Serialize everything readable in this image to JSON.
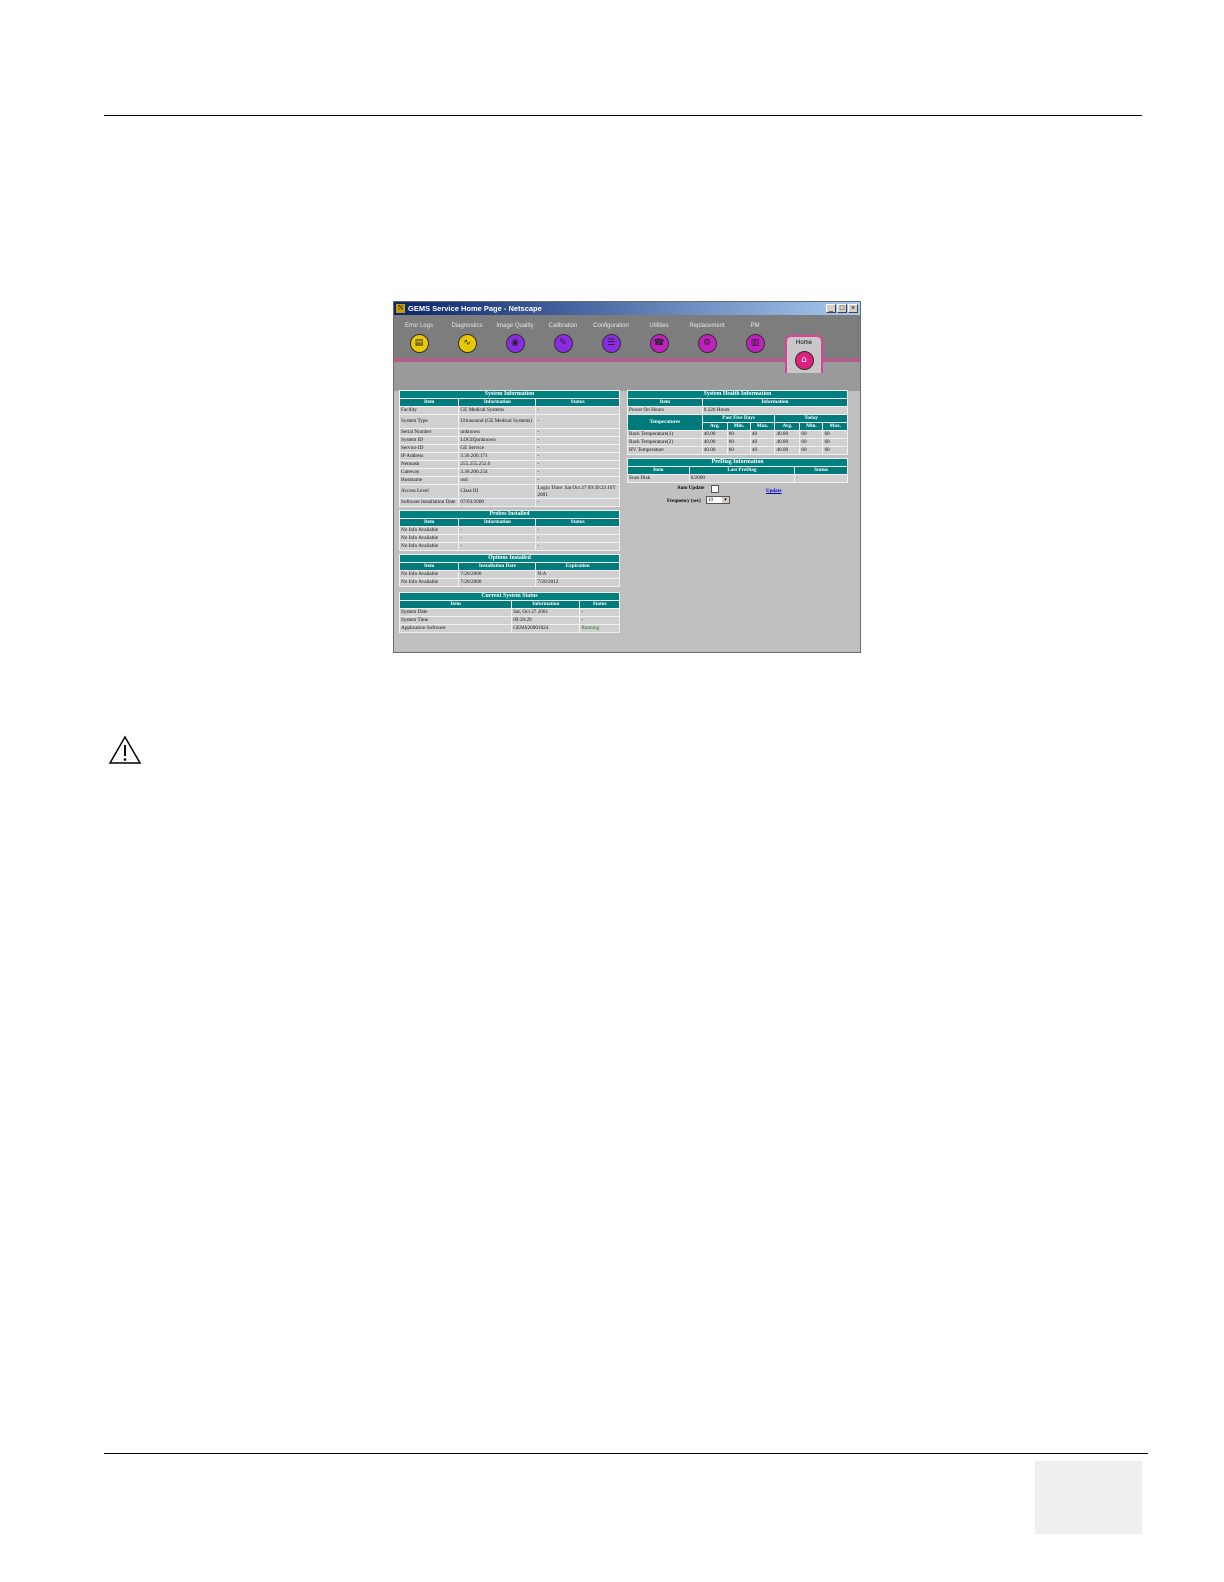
{
  "window": {
    "title": "GEMS Service Home Page - Netscape",
    "icon": "netscape-icon",
    "controls": [
      "_",
      "□",
      "×"
    ]
  },
  "nav": {
    "items": [
      {
        "label": "Error Logs",
        "icon": "log-icon",
        "color": "#e8c800"
      },
      {
        "label": "Diagnostics",
        "icon": "stethoscope-icon",
        "color": "#e8c800"
      },
      {
        "label": "Image Quality",
        "icon": "image-quality-icon",
        "color": "#8a2be2"
      },
      {
        "label": "Calibration",
        "icon": "calibration-icon",
        "color": "#8a2be2"
      },
      {
        "label": "Configuration",
        "icon": "configuration-icon",
        "color": "#8a2be2"
      },
      {
        "label": "Utilities",
        "icon": "utilities-icon",
        "color": "#c020c0"
      },
      {
        "label": "Replacement",
        "icon": "replacement-icon",
        "color": "#c020c0"
      },
      {
        "label": "PM",
        "icon": "pm-icon",
        "color": "#c020c0"
      }
    ],
    "home": {
      "label": "Home",
      "icon": "home-icon",
      "color": "#e02080"
    }
  },
  "system_info": {
    "caption": "System Information",
    "headers": [
      "Item",
      "Information",
      "Status"
    ],
    "rows": [
      [
        "Facility",
        "GE Medical Systems",
        "-"
      ],
      [
        "System Type",
        "Ultrasound (GE Medical Systems)",
        "-"
      ],
      [
        "Serial Number",
        "unknown",
        "-"
      ],
      [
        "System ID",
        "LOGIQunknown",
        "-"
      ],
      [
        "Service ID",
        "GE Service",
        "-"
      ],
      [
        "IP Address",
        "3.36.200.171",
        "-"
      ],
      [
        "Netmask",
        "255.255.252.0",
        "-"
      ],
      [
        "Gateway",
        "3.36.200.254",
        "-"
      ],
      [
        "Hostname",
        "usd",
        "-"
      ],
      [
        "Access Level",
        "Class III",
        "Login Time: Sat Oct 27 09:39:23 JST 2001"
      ],
      [
        "Software Installation Date",
        "07/03/2000",
        "-"
      ]
    ]
  },
  "probes": {
    "caption": "Probes Installed",
    "headers": [
      "Item",
      "Information",
      "Status"
    ],
    "rows": [
      [
        "No Info Available",
        "-",
        "-"
      ],
      [
        "No Info Available",
        "-",
        "-"
      ],
      [
        "No Info Available",
        "-",
        "-"
      ]
    ]
  },
  "options": {
    "caption": "Options Installed",
    "headers": [
      "Item",
      "Installation Date",
      "Expiration"
    ],
    "rows": [
      [
        "No Info Available",
        "7/20/2000",
        "N/A"
      ],
      [
        "No Info Available",
        "7/20/2000",
        "7/20/2012"
      ]
    ]
  },
  "current_status": {
    "caption": "Current System Status",
    "headers": [
      "Item",
      "Information",
      "Status"
    ],
    "rows": [
      [
        "System Date",
        "Sat, Oct 27 2001",
        "-"
      ],
      [
        "System Time",
        "09:39:29",
        "-"
      ],
      [
        "Application Software",
        "GEMS20001024",
        "Running"
      ]
    ]
  },
  "health": {
    "caption": "System Health Information",
    "headers": [
      "Item",
      "Information"
    ],
    "power_row": [
      "Power On Hours",
      "0.226 Hours"
    ],
    "temp_label": "Temperatures",
    "group_headers": [
      "Past Five Days",
      "Today"
    ],
    "sub_headers": [
      "Avg.",
      "Min.",
      "Max.",
      "Avg.",
      "Min.",
      "Max."
    ],
    "temp_rows": [
      [
        "Rack Temperature(1)",
        "40.00",
        "60",
        "40",
        "40.00",
        "60",
        "60"
      ],
      [
        "Rack Temperature(2)",
        "40.00",
        "60",
        "40",
        "40.00",
        "60",
        "60"
      ],
      [
        "HV Temperature",
        "40.00",
        "60",
        "40",
        "40.00",
        "60",
        "60"
      ]
    ]
  },
  "prediag": {
    "caption": "PreDiag Information",
    "headers": [
      "Item",
      "Last PreDiag",
      "Status"
    ],
    "rows": [
      [
        "Scan Disk",
        "6/2000",
        "-"
      ]
    ],
    "auto_update_label": "Auto Update",
    "update_link": "Update",
    "frequency_label": "Frequency (sec)",
    "frequency_value": "10"
  }
}
